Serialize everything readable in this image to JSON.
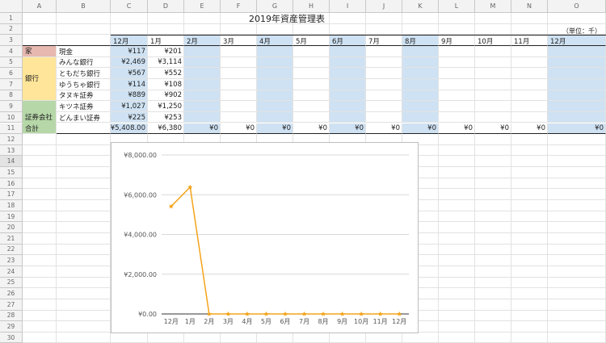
{
  "sheet": {
    "columns": [
      "A",
      "B",
      "C",
      "D",
      "E",
      "F",
      "G",
      "H",
      "I",
      "J",
      "K",
      "L",
      "M",
      "N",
      "O"
    ],
    "rows": [
      "1",
      "2",
      "3",
      "4",
      "5",
      "6",
      "7",
      "8",
      "9",
      "10",
      "11",
      "12",
      "13",
      "14",
      "15",
      "16",
      "17",
      "18",
      "19",
      "20",
      "21",
      "22",
      "23",
      "24",
      "25",
      "26",
      "27",
      "28",
      "29",
      "30"
    ],
    "title": "2019年資産管理表",
    "unit": "（単位：千）",
    "months": [
      "12月",
      "1月",
      "2月",
      "3月",
      "4月",
      "5月",
      "6月",
      "7月",
      "8月",
      "9月",
      "10月",
      "11月",
      "12月"
    ],
    "categories": [
      {
        "label": "家",
        "color": "#e6b8af"
      },
      {
        "label": "銀行",
        "color": "#ffe599"
      },
      {
        "label": "証券会社",
        "color": "#b6d7a8"
      }
    ],
    "accounts": [
      {
        "name": "現金",
        "dec": "¥117",
        "jan": "¥201"
      },
      {
        "name": "みんな銀行",
        "dec": "¥2,469",
        "jan": "¥3,114"
      },
      {
        "name": "ともだち銀行",
        "dec": "¥567",
        "jan": "¥552"
      },
      {
        "name": "ゆうちゃ銀行",
        "dec": "¥114",
        "jan": "¥108"
      },
      {
        "name": "タヌキ証券",
        "dec": "¥889",
        "jan": "¥902"
      },
      {
        "name": "キツネ証券",
        "dec": "¥1,027",
        "jan": "¥1,250"
      },
      {
        "name": "どんまい証券",
        "dec": "¥225",
        "jan": "¥253"
      }
    ],
    "total_label": "合計",
    "totals": [
      "¥5,408.00",
      "¥6,380",
      "¥0",
      "¥0",
      "¥0",
      "¥0",
      "¥0",
      "¥0",
      "¥0",
      "¥0",
      "¥0",
      "¥0",
      "¥0"
    ],
    "selected_row": "14"
  },
  "chart_data": {
    "type": "line",
    "categories": [
      "12月",
      "1月",
      "2月",
      "3月",
      "4月",
      "5月",
      "6月",
      "7月",
      "8月",
      "9月",
      "10月",
      "11月",
      "12月"
    ],
    "series": [
      {
        "values": [
          5408,
          6380,
          0,
          0,
          0,
          0,
          0,
          0,
          0,
          0,
          0,
          0,
          0
        ],
        "color": "#f4a31b"
      }
    ],
    "yticks": [
      "¥0.00",
      "¥2,000.00",
      "¥4,000.00",
      "¥6,000.00",
      "¥8,000.00"
    ],
    "ylim": [
      0,
      8000
    ],
    "grid": true,
    "legend": "none"
  }
}
